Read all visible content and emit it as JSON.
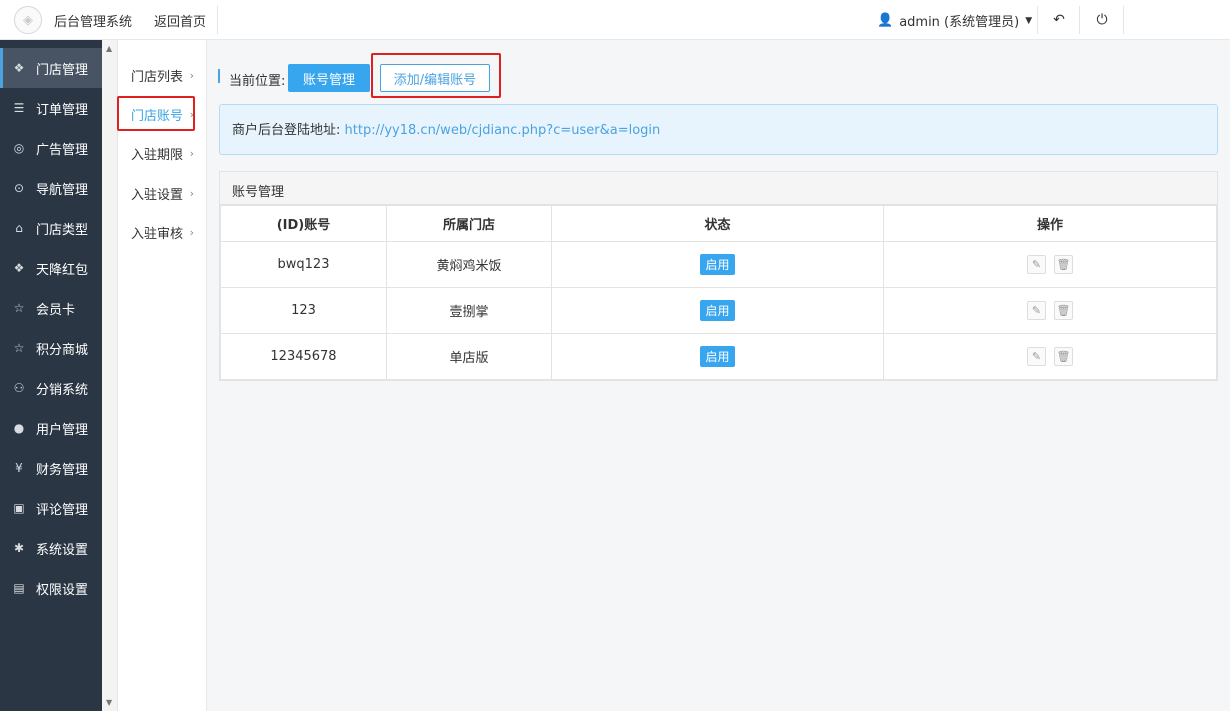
{
  "header": {
    "app_title": "后台管理系统",
    "home_link": "返回首页",
    "user": "admin (系统管理员)"
  },
  "sidebar": {
    "items": [
      {
        "label": "门店管理",
        "icon": "cubes-icon"
      },
      {
        "label": "订单管理",
        "icon": "list-icon"
      },
      {
        "label": "广告管理",
        "icon": "lifebuoy-icon"
      },
      {
        "label": "导航管理",
        "icon": "compass-icon"
      },
      {
        "label": "门店类型",
        "icon": "bank-icon"
      },
      {
        "label": "天降红包",
        "icon": "cubes-icon"
      },
      {
        "label": "会员卡",
        "icon": "star-icon"
      },
      {
        "label": "积分商城",
        "icon": "star-icon"
      },
      {
        "label": "分销系统",
        "icon": "users-icon"
      },
      {
        "label": "用户管理",
        "icon": "user-icon"
      },
      {
        "label": "财务管理",
        "icon": "yen-icon"
      },
      {
        "label": "评论管理",
        "icon": "money-icon"
      },
      {
        "label": "系统设置",
        "icon": "gear-icon"
      },
      {
        "label": "权限设置",
        "icon": "lock-icon"
      }
    ]
  },
  "submenu": {
    "items": [
      {
        "label": "门店列表"
      },
      {
        "label": "门店账号"
      },
      {
        "label": "入驻期限"
      },
      {
        "label": "入驻设置"
      },
      {
        "label": "入驻审核"
      }
    ]
  },
  "breadcrumb": {
    "label": "当前位置:",
    "current": "账号管理",
    "add_button": "添加/编辑账号"
  },
  "notice": {
    "label": "商户后台登陆地址:",
    "url": "http://yy18.cn/web/cjdianc.php?c=user&a=login"
  },
  "panel": {
    "title": "账号管理",
    "columns": [
      "(ID)账号",
      "所属门店",
      "状态",
      "操作"
    ],
    "rows": [
      {
        "account": "bwq123",
        "store": "黄焖鸡米饭",
        "status": "启用"
      },
      {
        "account": "123",
        "store": "壹捌掌",
        "status": "启用"
      },
      {
        "account": "12345678",
        "store": "单店版",
        "status": "启用"
      }
    ]
  },
  "colors": {
    "accent": "#37a6ef",
    "sidebar_bg": "#2b3644",
    "highlight_box": "#e02020"
  }
}
